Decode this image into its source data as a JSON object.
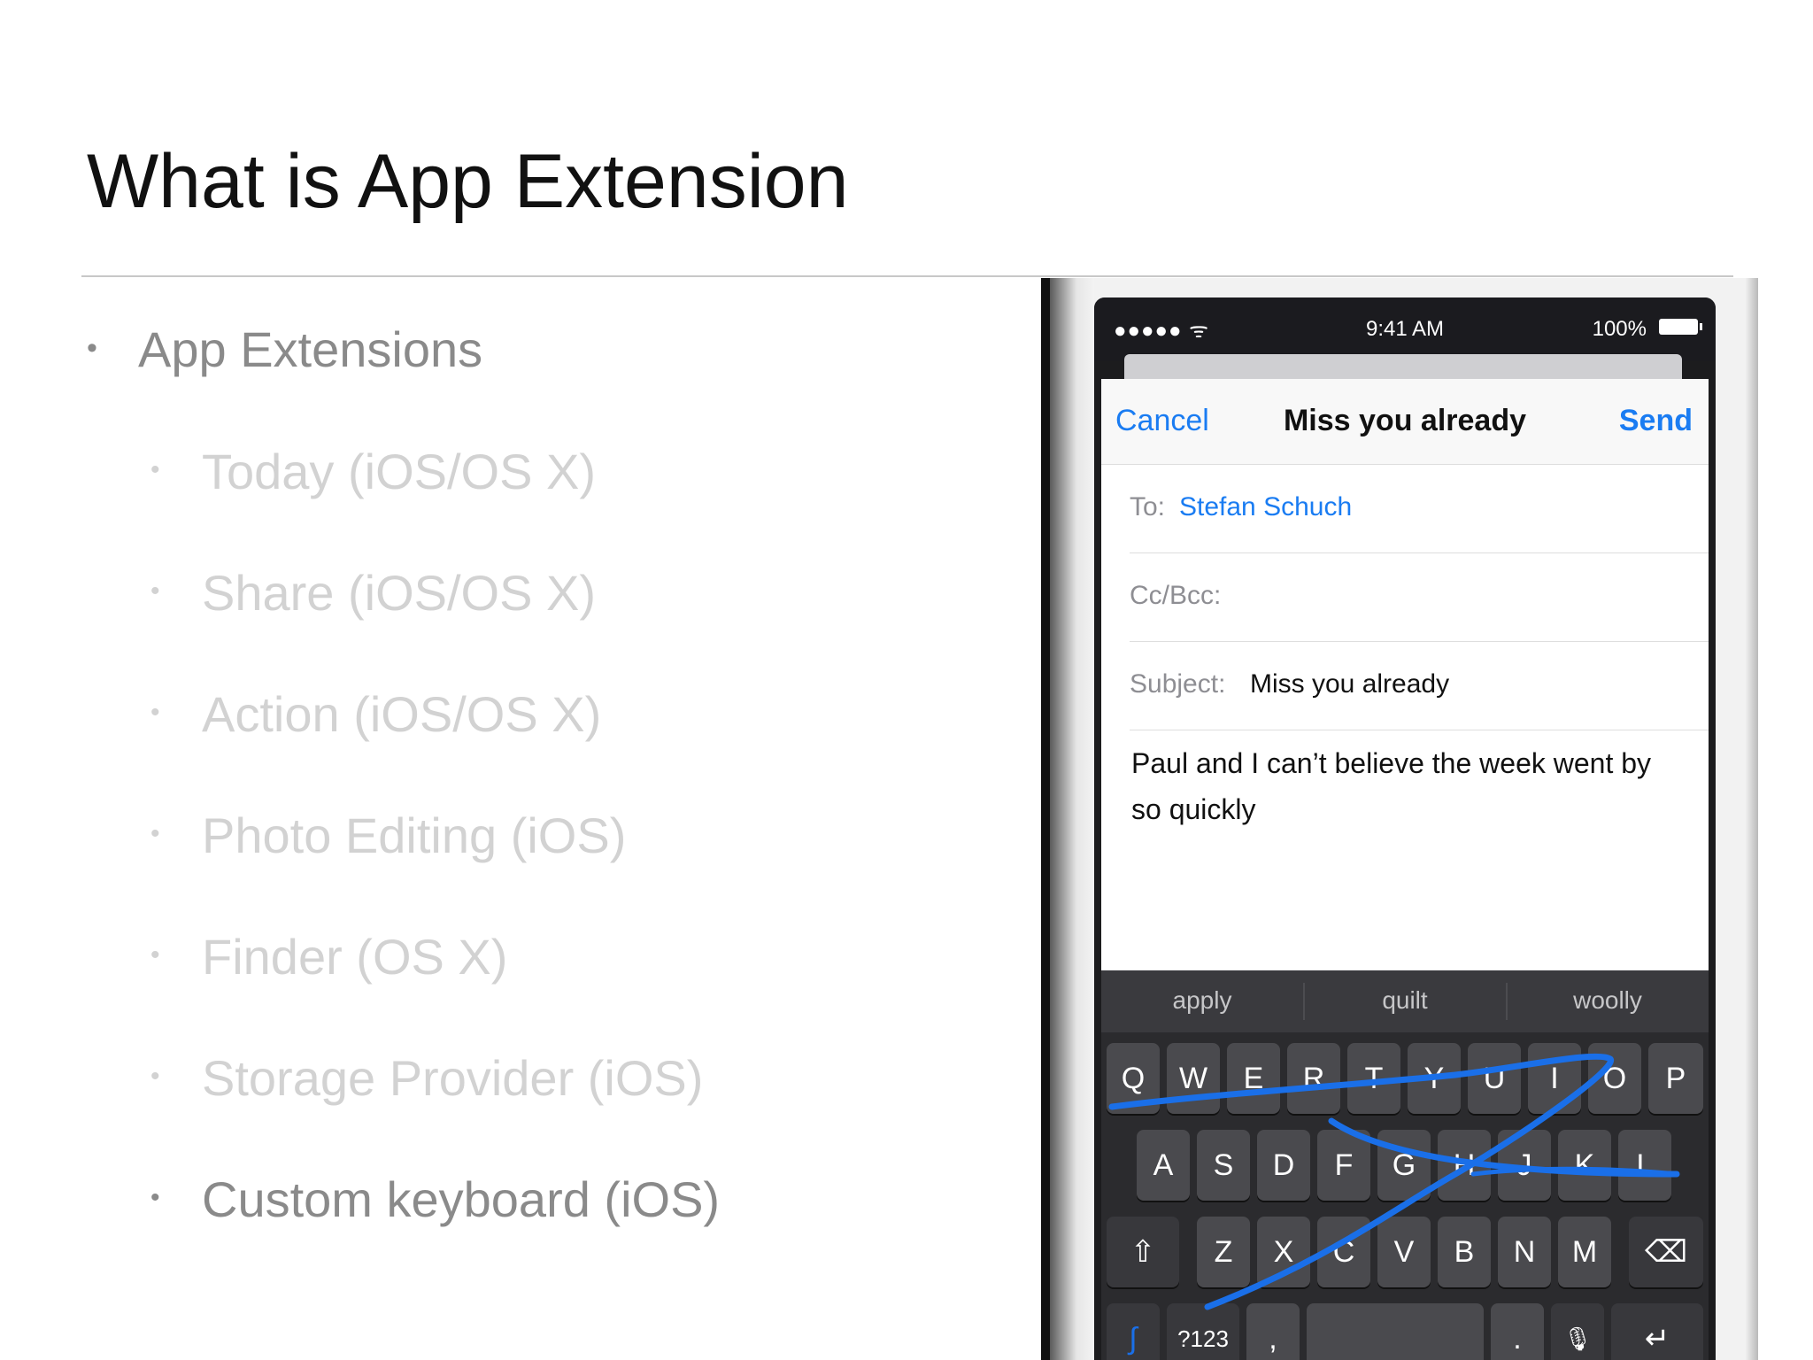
{
  "slide": {
    "title": "What is App Extension",
    "bullets": [
      {
        "text": "App Extensions",
        "level": 1
      },
      {
        "text": "Today (iOS/OS X)",
        "level": 2
      },
      {
        "text": "Share (iOS/OS X)",
        "level": 2
      },
      {
        "text": "Action (iOS/OS X)",
        "level": 2
      },
      {
        "text": "Photo Editing (iOS)",
        "level": 2
      },
      {
        "text": "Finder (OS X)",
        "level": 2
      },
      {
        "text": "Storage Provider (iOS)",
        "level": 2
      },
      {
        "text": "Custom keyboard (iOS)",
        "level": 2,
        "highlighted": true
      }
    ],
    "bullet_glyph": "•"
  },
  "phone": {
    "status": {
      "signal": "●●●●● ᯤ",
      "time": "9:41 AM",
      "battery": "100%"
    },
    "mail": {
      "cancel": "Cancel",
      "title": "Miss you already",
      "send": "Send",
      "to_label": "To:",
      "to_value": "Stefan Schuch",
      "cc_label": "Cc/Bcc:",
      "subject_label": "Subject:",
      "subject_value": "Miss you already",
      "body": "Paul and I can’t believe the week went by so quickly"
    },
    "suggestions": [
      "apply",
      "quilt",
      "woolly"
    ],
    "keyboard": {
      "row1": [
        "Q",
        "W",
        "E",
        "R",
        "T",
        "Y",
        "U",
        "I",
        "O",
        "P"
      ],
      "row2": [
        "A",
        "S",
        "D",
        "F",
        "G",
        "H",
        "J",
        "K",
        "L"
      ],
      "row3": [
        "Z",
        "X",
        "C",
        "V",
        "B",
        "N",
        "M"
      ],
      "shift_icon": "⇧",
      "backspace_icon": "⌫",
      "numbers": "?123",
      "comma": ",",
      "period": ".",
      "mic_icon": "🎙",
      "return_icon": "↵",
      "swipe_icon": "∫"
    },
    "colors": {
      "accent": "#1a7cf2",
      "swipe_trail": "#1a6fe8"
    }
  }
}
